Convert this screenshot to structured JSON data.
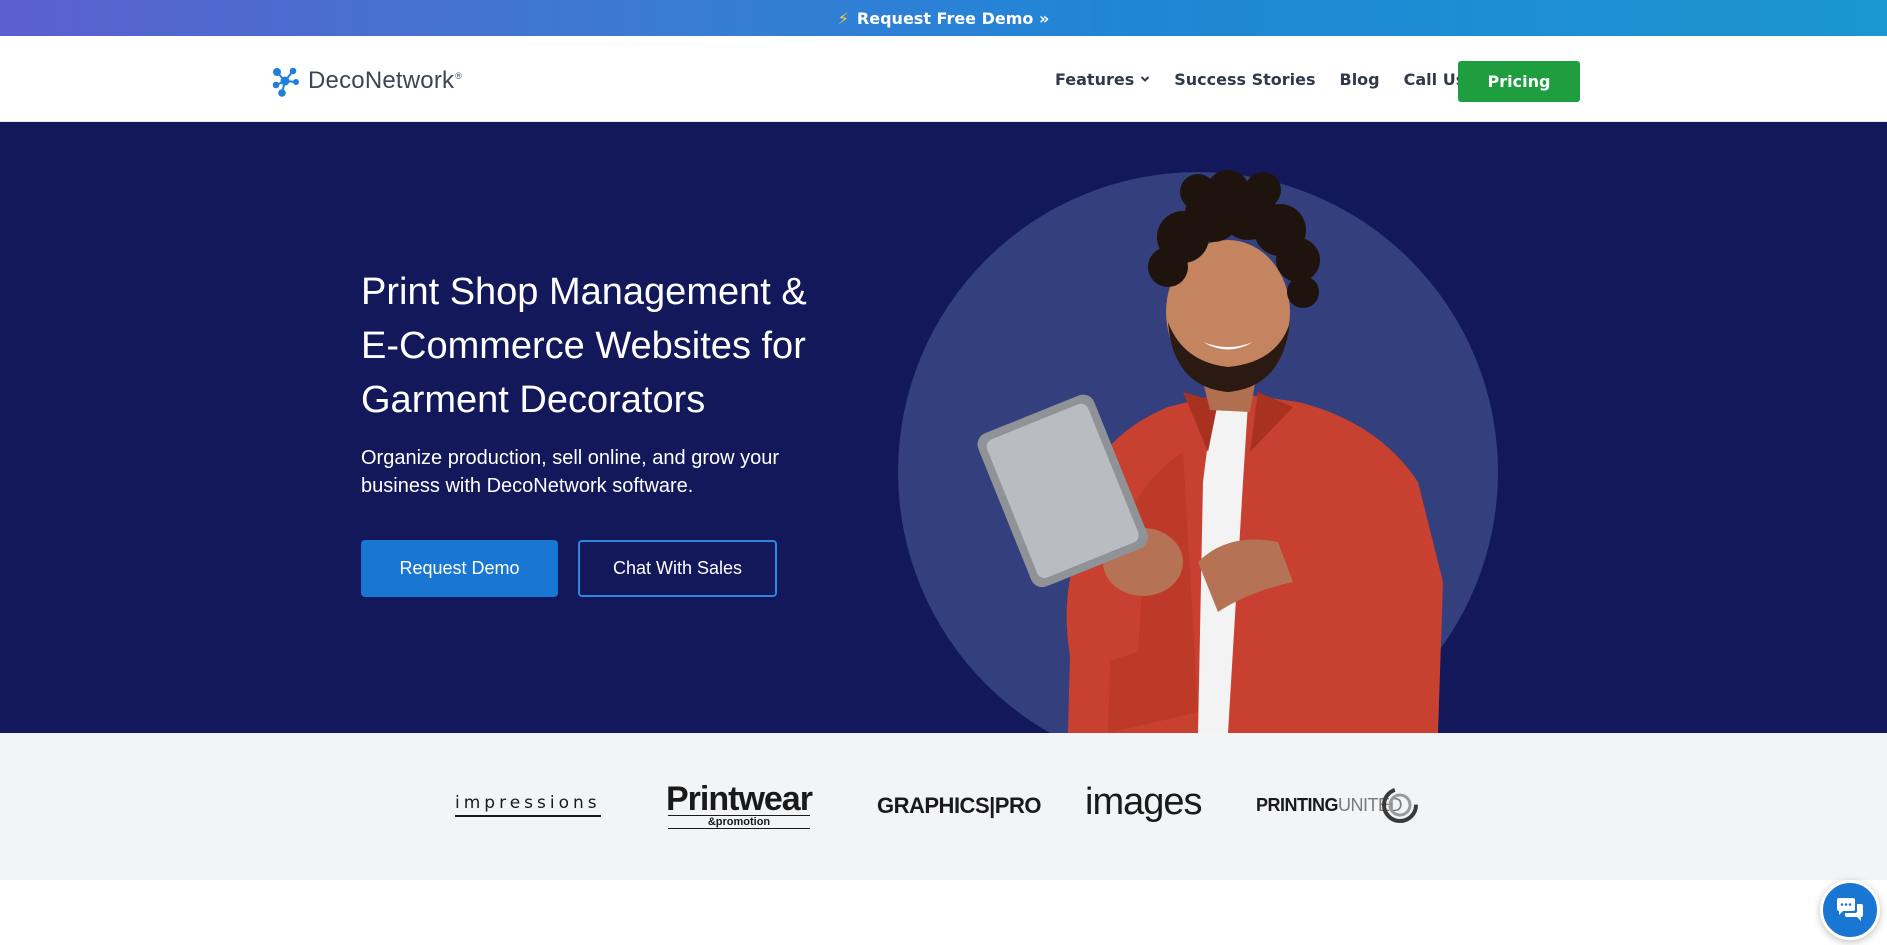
{
  "promo": {
    "icon": "bolt-icon",
    "label": "Request Free Demo »"
  },
  "header": {
    "logo_text": "DecoNetwork",
    "logo_reg": "®",
    "nav": [
      {
        "label": "Features",
        "has_dropdown": true
      },
      {
        "label": "Success Stories",
        "has_dropdown": false
      },
      {
        "label": "Blog",
        "has_dropdown": false
      },
      {
        "label": "Call Us",
        "has_dropdown": true
      }
    ],
    "pricing_label": "Pricing"
  },
  "hero": {
    "title": "Print Shop Management & E-Commerce Websites for Garment Decorators",
    "subtitle": "Organize production, sell online, and grow your business with DecoNetwork software.",
    "primary_cta": "Request Demo",
    "secondary_cta": "Chat With Sales"
  },
  "press_logos": [
    {
      "name": "impressions",
      "text": "impressions"
    },
    {
      "name": "printwear",
      "text": "Printwear",
      "subtext": "&promotion"
    },
    {
      "name": "graphicspro",
      "text": "GRAPHICS|PRO"
    },
    {
      "name": "images",
      "text": "images"
    },
    {
      "name": "printingunited",
      "text_a": "PRINTING",
      "text_b": "UNITED"
    }
  ],
  "colors": {
    "hero_bg": "#12185a",
    "circle": "#343f7e",
    "primary": "#1976d2",
    "pricing_green": "#1e9e3e"
  },
  "chat_widget": {
    "icon": "chat-bubbles-icon"
  }
}
